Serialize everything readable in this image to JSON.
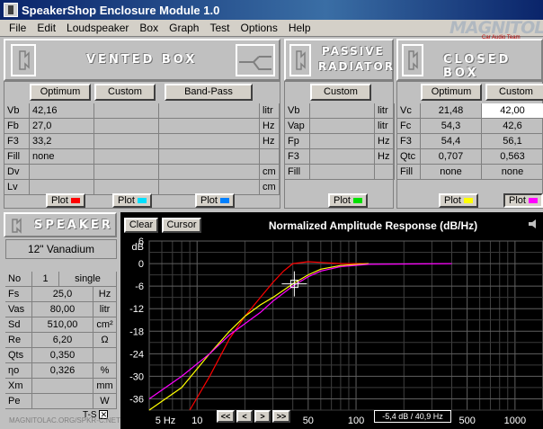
{
  "window": {
    "title": "SpeakerShop Enclosure Module 1.0"
  },
  "menu": [
    "File",
    "Edit",
    "Loudspeaker",
    "Box",
    "Graph",
    "Test",
    "Options",
    "Help"
  ],
  "logo": {
    "text": "MAGNITOLA",
    "sub": "Car Audio Team"
  },
  "vented": {
    "title": "VENTED BOX",
    "buttons": {
      "optimum": "Optimum",
      "custom": "Custom",
      "bandpass": "Band-Pass"
    },
    "rows": [
      {
        "param": "Vb",
        "optimum": "42,16",
        "unit": "litr"
      },
      {
        "param": "Fb",
        "optimum": "27,0",
        "unit": "Hz"
      },
      {
        "param": "F3",
        "optimum": "33,2",
        "unit": "Hz"
      },
      {
        "param": "Fill",
        "optimum": "none",
        "unit": ""
      },
      {
        "param": "Dv",
        "optimum": "",
        "unit": "cm"
      },
      {
        "param": "Lv",
        "optimum": "",
        "unit": "cm"
      }
    ],
    "plot_label": "Plot",
    "swatches": [
      "#ff0000",
      "#00e0ff",
      "#0080ff"
    ]
  },
  "passive": {
    "title_line1": "PASSIVE",
    "title_line2": "RADIATOR",
    "buttons": {
      "custom": "Custom"
    },
    "rows": [
      {
        "param": "Vb",
        "unit": "litr"
      },
      {
        "param": "Vap",
        "unit": "litr"
      },
      {
        "param": "Fp",
        "unit": "Hz"
      },
      {
        "param": "F3",
        "unit": "Hz"
      },
      {
        "param": "Fill",
        "unit": ""
      }
    ],
    "plot_label": "Plot",
    "swatch": "#00e000"
  },
  "closed": {
    "title": "CLOSED BOX",
    "buttons": {
      "optimum": "Optimum",
      "custom": "Custom"
    },
    "rows": [
      {
        "param": "Vc",
        "optimum": "21,48",
        "custom": "42,00"
      },
      {
        "param": "Fc",
        "optimum": "54,3",
        "custom": "42,6"
      },
      {
        "param": "F3",
        "optimum": "54,4",
        "custom": "56,1"
      },
      {
        "param": "Qtc",
        "optimum": "0,707",
        "custom": "0,563"
      },
      {
        "param": "Fill",
        "optimum": "none",
        "custom": "none"
      }
    ],
    "plot_label": "Plot",
    "swatches": [
      "#ffff00",
      "#ff00ff"
    ]
  },
  "speaker": {
    "title": "SPEAKER",
    "name": "12\" Vanadium",
    "no_label": "No",
    "no_value": "1",
    "mode": "single",
    "rows": [
      {
        "param": "Fs",
        "value": "25,0",
        "unit": "Hz"
      },
      {
        "param": "Vas",
        "value": "80,00",
        "unit": "litr"
      },
      {
        "param": "Sd",
        "value": "510,00",
        "unit": "cm²"
      },
      {
        "param": "Re",
        "value": "6,20",
        "unit": "Ω"
      },
      {
        "param": "Qts",
        "value": "0,350",
        "unit": ""
      },
      {
        "param": "ηo",
        "value": "0,326",
        "unit": "%"
      },
      {
        "param": "Xm",
        "value": "",
        "unit": "mm"
      },
      {
        "param": "Pe",
        "value": "",
        "unit": "W"
      }
    ],
    "ts_label": "T-S",
    "footer": "MAGNITOLAC.ORG/SPKR-C.NET"
  },
  "graph": {
    "clear": "Clear",
    "cursor": "Cursor",
    "title": "Normalized Amplitude Response (dB/Hz)",
    "ylabel": "dB",
    "nav": [
      "<<",
      "<",
      ">",
      ">>"
    ],
    "readout": "-5,4 dB / 40,9 Hz"
  },
  "chart_data": {
    "type": "line",
    "title": "Normalized Amplitude Response (dB/Hz)",
    "xlabel": "Hz",
    "ylabel": "dB",
    "xscale": "log",
    "xlim": [
      5,
      1500
    ],
    "ylim": [
      -39,
      6
    ],
    "yticks": [
      6,
      0,
      -6,
      -12,
      -18,
      -24,
      -30,
      -36
    ],
    "xticks": [
      5,
      10,
      50,
      100,
      500,
      1000
    ],
    "xtick_labels": [
      "5 Hz",
      "10",
      "50",
      "100",
      "500",
      "1000"
    ],
    "grid": true,
    "series": [
      {
        "color": "#ff0000",
        "x": [
          9,
          12,
          16,
          20,
          25,
          30,
          35,
          40,
          50,
          60,
          80,
          120
        ],
        "y": [
          -39,
          -30,
          -20,
          -14,
          -9,
          -5,
          -2,
          0,
          0.5,
          0.3,
          0,
          0
        ]
      },
      {
        "color": "#ffff00",
        "x": [
          5,
          8,
          12,
          16,
          20,
          25,
          30,
          40,
          50,
          60,
          80,
          120
        ],
        "y": [
          -39,
          -33,
          -24,
          -18,
          -14,
          -11,
          -9,
          -5.4,
          -3,
          -1.5,
          -0.5,
          0
        ]
      },
      {
        "color": "#ff00ff",
        "x": [
          5,
          8,
          12,
          16,
          20,
          25,
          30,
          40,
          50,
          60,
          80,
          120,
          400
        ],
        "y": [
          -36,
          -30,
          -24,
          -19,
          -16,
          -13,
          -10,
          -6,
          -3.5,
          -2,
          -0.8,
          -0.2,
          0
        ]
      }
    ],
    "cursor": {
      "x": 40.9,
      "y": -5.4
    }
  }
}
